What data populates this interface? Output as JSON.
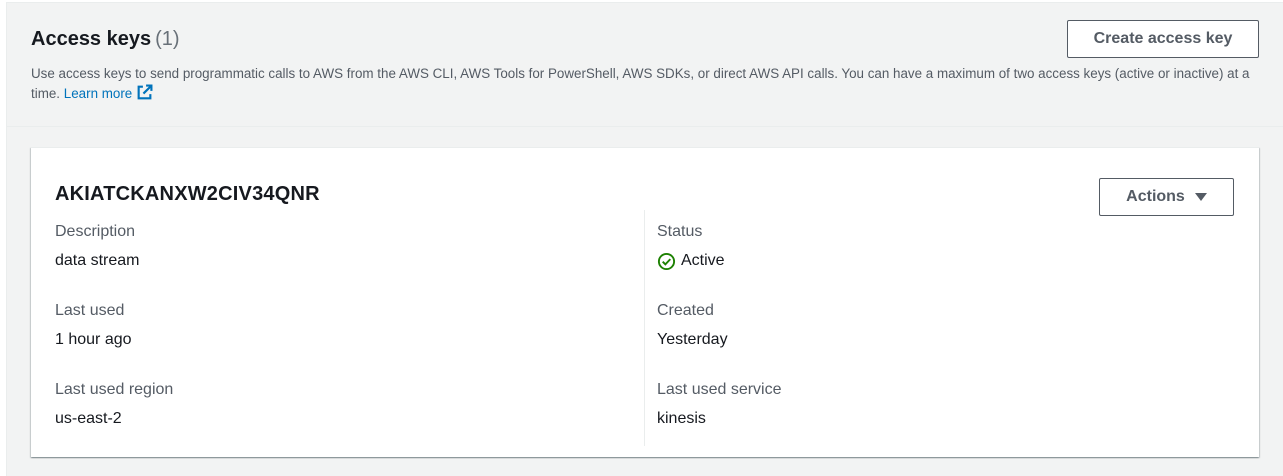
{
  "header": {
    "title": "Access keys",
    "count": "(1)",
    "description": "Use access keys to send programmatic calls to AWS from the AWS CLI, AWS Tools for PowerShell, AWS SDKs, or direct AWS API calls. You can have a maximum of two access keys (active or inactive) at a time.",
    "learn_more": "Learn more",
    "create_button": "Create access key"
  },
  "key": {
    "id": "AKIATCKANXW2CIV34QNR",
    "actions_button": "Actions",
    "fields": {
      "description_label": "Description",
      "description_value": "data stream",
      "last_used_label": "Last used",
      "last_used_value": "1 hour ago",
      "last_used_region_label": "Last used region",
      "last_used_region_value": "us-east-2",
      "status_label": "Status",
      "status_value": "Active",
      "created_label": "Created",
      "created_value": "Yesterday",
      "last_used_service_label": "Last used service",
      "last_used_service_value": "kinesis"
    }
  },
  "colors": {
    "link": "#0073bb",
    "status_active": "#1d8102",
    "panel_bg": "#f2f3f3",
    "button_border": "#545b64"
  },
  "icons": {
    "external_link": "external-link-icon",
    "status": "check-circle-icon",
    "dropdown": "caret-down-icon"
  }
}
